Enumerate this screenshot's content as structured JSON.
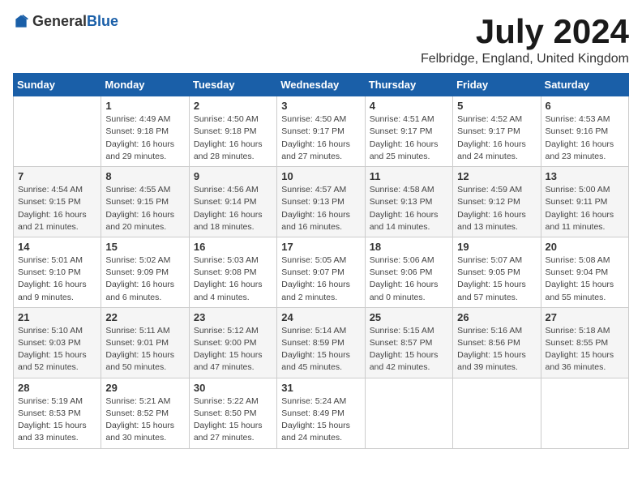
{
  "header": {
    "logo_general": "General",
    "logo_blue": "Blue",
    "month": "July 2024",
    "location": "Felbridge, England, United Kingdom"
  },
  "days_of_week": [
    "Sunday",
    "Monday",
    "Tuesday",
    "Wednesday",
    "Thursday",
    "Friday",
    "Saturday"
  ],
  "weeks": [
    [
      {
        "day": "",
        "info": ""
      },
      {
        "day": "1",
        "info": "Sunrise: 4:49 AM\nSunset: 9:18 PM\nDaylight: 16 hours\nand 29 minutes."
      },
      {
        "day": "2",
        "info": "Sunrise: 4:50 AM\nSunset: 9:18 PM\nDaylight: 16 hours\nand 28 minutes."
      },
      {
        "day": "3",
        "info": "Sunrise: 4:50 AM\nSunset: 9:17 PM\nDaylight: 16 hours\nand 27 minutes."
      },
      {
        "day": "4",
        "info": "Sunrise: 4:51 AM\nSunset: 9:17 PM\nDaylight: 16 hours\nand 25 minutes."
      },
      {
        "day": "5",
        "info": "Sunrise: 4:52 AM\nSunset: 9:17 PM\nDaylight: 16 hours\nand 24 minutes."
      },
      {
        "day": "6",
        "info": "Sunrise: 4:53 AM\nSunset: 9:16 PM\nDaylight: 16 hours\nand 23 minutes."
      }
    ],
    [
      {
        "day": "7",
        "info": "Sunrise: 4:54 AM\nSunset: 9:15 PM\nDaylight: 16 hours\nand 21 minutes."
      },
      {
        "day": "8",
        "info": "Sunrise: 4:55 AM\nSunset: 9:15 PM\nDaylight: 16 hours\nand 20 minutes."
      },
      {
        "day": "9",
        "info": "Sunrise: 4:56 AM\nSunset: 9:14 PM\nDaylight: 16 hours\nand 18 minutes."
      },
      {
        "day": "10",
        "info": "Sunrise: 4:57 AM\nSunset: 9:13 PM\nDaylight: 16 hours\nand 16 minutes."
      },
      {
        "day": "11",
        "info": "Sunrise: 4:58 AM\nSunset: 9:13 PM\nDaylight: 16 hours\nand 14 minutes."
      },
      {
        "day": "12",
        "info": "Sunrise: 4:59 AM\nSunset: 9:12 PM\nDaylight: 16 hours\nand 13 minutes."
      },
      {
        "day": "13",
        "info": "Sunrise: 5:00 AM\nSunset: 9:11 PM\nDaylight: 16 hours\nand 11 minutes."
      }
    ],
    [
      {
        "day": "14",
        "info": "Sunrise: 5:01 AM\nSunset: 9:10 PM\nDaylight: 16 hours\nand 9 minutes."
      },
      {
        "day": "15",
        "info": "Sunrise: 5:02 AM\nSunset: 9:09 PM\nDaylight: 16 hours\nand 6 minutes."
      },
      {
        "day": "16",
        "info": "Sunrise: 5:03 AM\nSunset: 9:08 PM\nDaylight: 16 hours\nand 4 minutes."
      },
      {
        "day": "17",
        "info": "Sunrise: 5:05 AM\nSunset: 9:07 PM\nDaylight: 16 hours\nand 2 minutes."
      },
      {
        "day": "18",
        "info": "Sunrise: 5:06 AM\nSunset: 9:06 PM\nDaylight: 16 hours\nand 0 minutes."
      },
      {
        "day": "19",
        "info": "Sunrise: 5:07 AM\nSunset: 9:05 PM\nDaylight: 15 hours\nand 57 minutes."
      },
      {
        "day": "20",
        "info": "Sunrise: 5:08 AM\nSunset: 9:04 PM\nDaylight: 15 hours\nand 55 minutes."
      }
    ],
    [
      {
        "day": "21",
        "info": "Sunrise: 5:10 AM\nSunset: 9:03 PM\nDaylight: 15 hours\nand 52 minutes."
      },
      {
        "day": "22",
        "info": "Sunrise: 5:11 AM\nSunset: 9:01 PM\nDaylight: 15 hours\nand 50 minutes."
      },
      {
        "day": "23",
        "info": "Sunrise: 5:12 AM\nSunset: 9:00 PM\nDaylight: 15 hours\nand 47 minutes."
      },
      {
        "day": "24",
        "info": "Sunrise: 5:14 AM\nSunset: 8:59 PM\nDaylight: 15 hours\nand 45 minutes."
      },
      {
        "day": "25",
        "info": "Sunrise: 5:15 AM\nSunset: 8:57 PM\nDaylight: 15 hours\nand 42 minutes."
      },
      {
        "day": "26",
        "info": "Sunrise: 5:16 AM\nSunset: 8:56 PM\nDaylight: 15 hours\nand 39 minutes."
      },
      {
        "day": "27",
        "info": "Sunrise: 5:18 AM\nSunset: 8:55 PM\nDaylight: 15 hours\nand 36 minutes."
      }
    ],
    [
      {
        "day": "28",
        "info": "Sunrise: 5:19 AM\nSunset: 8:53 PM\nDaylight: 15 hours\nand 33 minutes."
      },
      {
        "day": "29",
        "info": "Sunrise: 5:21 AM\nSunset: 8:52 PM\nDaylight: 15 hours\nand 30 minutes."
      },
      {
        "day": "30",
        "info": "Sunrise: 5:22 AM\nSunset: 8:50 PM\nDaylight: 15 hours\nand 27 minutes."
      },
      {
        "day": "31",
        "info": "Sunrise: 5:24 AM\nSunset: 8:49 PM\nDaylight: 15 hours\nand 24 minutes."
      },
      {
        "day": "",
        "info": ""
      },
      {
        "day": "",
        "info": ""
      },
      {
        "day": "",
        "info": ""
      }
    ]
  ]
}
